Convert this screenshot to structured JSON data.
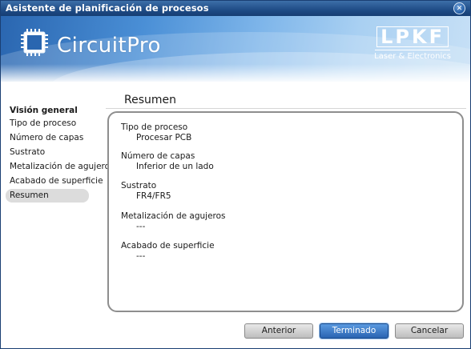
{
  "window": {
    "title": "Asistente de planificación de procesos",
    "close_glyph": "✕"
  },
  "banner": {
    "product": "CircuitPro",
    "logo": "LPKF",
    "tagline": "Laser & Electronics"
  },
  "sidebar": {
    "heading": "Visión general",
    "items": [
      {
        "label": "Tipo de proceso",
        "active": false
      },
      {
        "label": "Número de capas",
        "active": false
      },
      {
        "label": "Sustrato",
        "active": false
      },
      {
        "label": "Metalización de agujeros",
        "active": false
      },
      {
        "label": "Acabado de superficie",
        "active": false
      },
      {
        "label": "Resumen",
        "active": true
      }
    ]
  },
  "main": {
    "title": "Resumen",
    "summary": [
      {
        "label": "Tipo de proceso",
        "value": "Procesar PCB"
      },
      {
        "label": "Número de capas",
        "value": "Inferior de un lado"
      },
      {
        "label": "Sustrato",
        "value": "FR4/FR5"
      },
      {
        "label": "Metalización de agujeros",
        "value": "---"
      },
      {
        "label": "Acabado de superficie",
        "value": "---"
      }
    ]
  },
  "buttons": {
    "previous": "Anterior",
    "finish": "Terminado",
    "cancel": "Cancelar"
  },
  "colors": {
    "titlebar": "#1f4c86",
    "accent": "#2a64b2",
    "active_item_bg": "#dcdcdc"
  },
  "icons": {
    "product": "circuit-chip-icon",
    "close": "close-icon"
  }
}
